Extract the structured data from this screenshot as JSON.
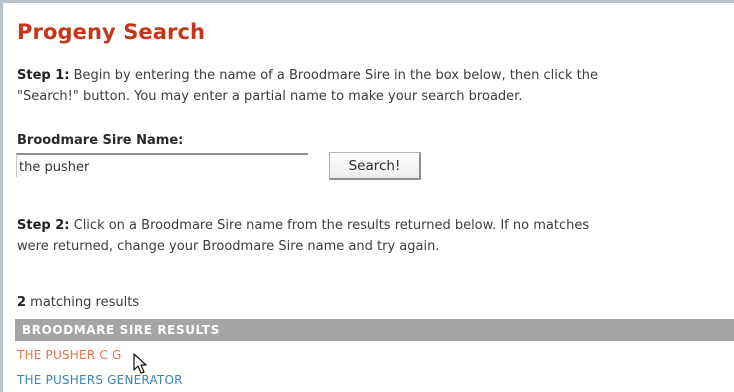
{
  "page": {
    "title": "Progeny Search"
  },
  "step1": {
    "label": "Step 1:",
    "line1": " Begin by entering the name of a Broodmare Sire in the box below, then click the",
    "line2": "\"Search!\" button.  You may enter a partial name to make your search broader."
  },
  "search": {
    "label": "Broodmare Sire Name:",
    "value": "the pusher",
    "button_label": "Search!"
  },
  "step2": {
    "label": "Step 2:",
    "line1": " Click on a Broodmare Sire name from the results returned below. If no matches",
    "line2": "were returned, change your Broodmare Sire name and try again."
  },
  "results": {
    "count": "2",
    "count_suffix": " matching results",
    "header": "BROODMARE SIRE RESULTS",
    "items": [
      {
        "label": "THE PUSHER C G",
        "color": "#ea7441"
      },
      {
        "label": "THE PUSHERS GENERATOR",
        "color": "#3c82b9"
      }
    ]
  },
  "colors": {
    "title": "#c3361c",
    "header_bg": "#a5a5a5",
    "frame_border": "#b9c4cd"
  },
  "cursor": {
    "icon": "arrow-pointer-icon"
  }
}
